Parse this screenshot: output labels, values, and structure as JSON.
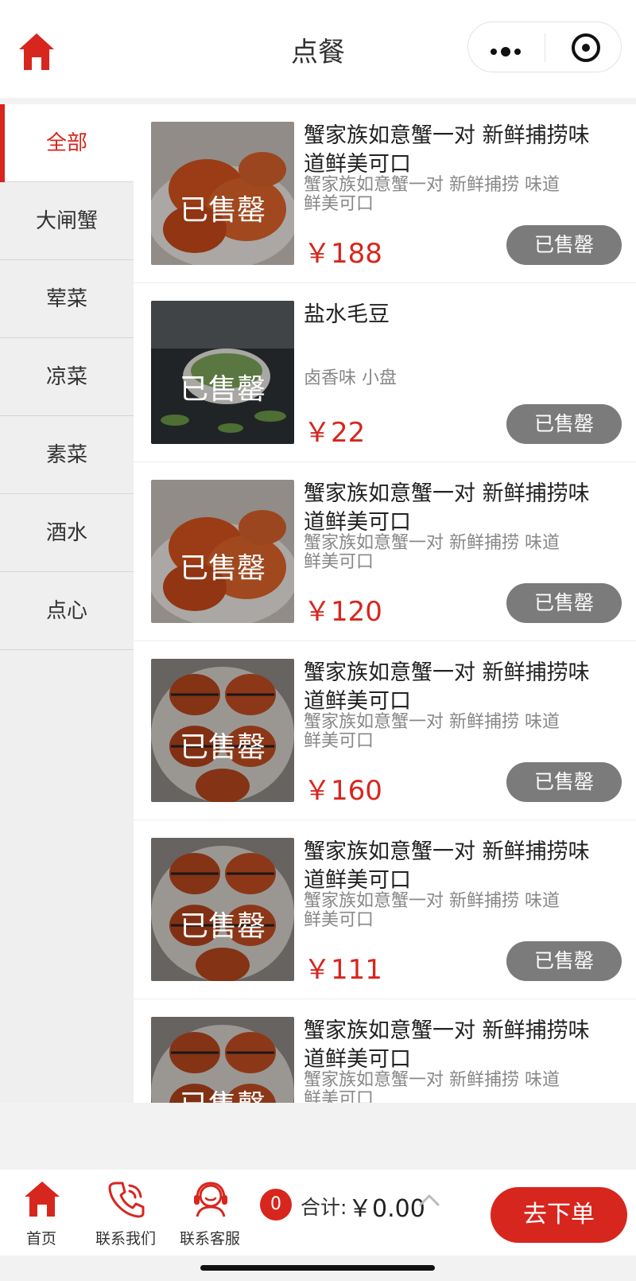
{
  "header": {
    "title": "点餐"
  },
  "sidebar": {
    "items": [
      {
        "label": "全部"
      },
      {
        "label": "大闸蟹"
      },
      {
        "label": "荤菜"
      },
      {
        "label": "凉菜"
      },
      {
        "label": "素菜"
      },
      {
        "label": "酒水"
      },
      {
        "label": "点心"
      }
    ]
  },
  "products": [
    {
      "name": "蟹家族如意蟹一对 新鲜捕捞味道鲜美可口",
      "desc": "蟹家族如意蟹一对 新鲜捕捞 味道鲜美可口",
      "price": "￥188",
      "overlay": "已售罄",
      "button": "已售罄"
    },
    {
      "name": "盐水毛豆",
      "desc": "卤香味 小盘",
      "price": "￥22",
      "overlay": "已售罄",
      "button": "已售罄"
    },
    {
      "name": "蟹家族如意蟹一对 新鲜捕捞味道鲜美可口",
      "desc": "蟹家族如意蟹一对 新鲜捕捞 味道鲜美可口",
      "price": "￥120",
      "overlay": "已售罄",
      "button": "已售罄"
    },
    {
      "name": "蟹家族如意蟹一对 新鲜捕捞味道鲜美可口",
      "desc": "蟹家族如意蟹一对 新鲜捕捞 味道鲜美可口",
      "price": "￥160",
      "overlay": "已售罄",
      "button": "已售罄"
    },
    {
      "name": "蟹家族如意蟹一对 新鲜捕捞味道鲜美可口",
      "desc": "蟹家族如意蟹一对 新鲜捕捞 味道鲜美可口",
      "price": "￥111",
      "overlay": "已售罄",
      "button": "已售罄"
    },
    {
      "name": "蟹家族如意蟹一对 新鲜捕捞味道鲜美可口",
      "desc": "蟹家族如意蟹一对 新鲜捕捞 味道鲜美可口",
      "overlay": "已售罄"
    }
  ],
  "bottom_bar": {
    "tabs": [
      {
        "label": "首页",
        "icon": "home-icon"
      },
      {
        "label": "联系我们",
        "icon": "phone-icon"
      },
      {
        "label": "联系客服",
        "icon": "headset-icon"
      }
    ],
    "cart_count": "0",
    "total_label": "合计:",
    "total_value": "￥0.00",
    "order_button": "去下单"
  },
  "colors": {
    "accent": "#d7261e",
    "sold_out_button": "#7b7b7b"
  }
}
